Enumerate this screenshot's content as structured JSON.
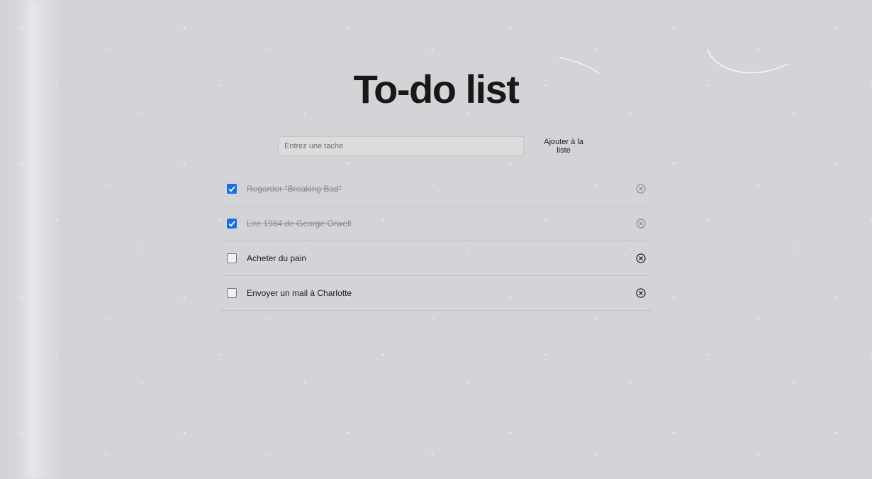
{
  "app": {
    "title": "To-do list"
  },
  "form": {
    "input_value": "",
    "input_placeholder": "Entrez une tache",
    "add_label": "Ajouter à la liste"
  },
  "colors": {
    "background": "#d3d4d8",
    "checked": "#1a6fe2",
    "text": "#1b1b1b",
    "done_text": "#8a8a8d"
  },
  "todos": [
    {
      "label": "Regarder \"Breaking Bad\"",
      "checked": true,
      "delete_icon": "close-circle-icon"
    },
    {
      "label": "Lire 1984 de George Orwell",
      "checked": true,
      "delete_icon": "close-circle-icon"
    },
    {
      "label": "Acheter du pain",
      "checked": false,
      "delete_icon": "close-circle-icon"
    },
    {
      "label": "Envoyer un mail à Charlotte",
      "checked": false,
      "delete_icon": "close-circle-icon"
    }
  ]
}
